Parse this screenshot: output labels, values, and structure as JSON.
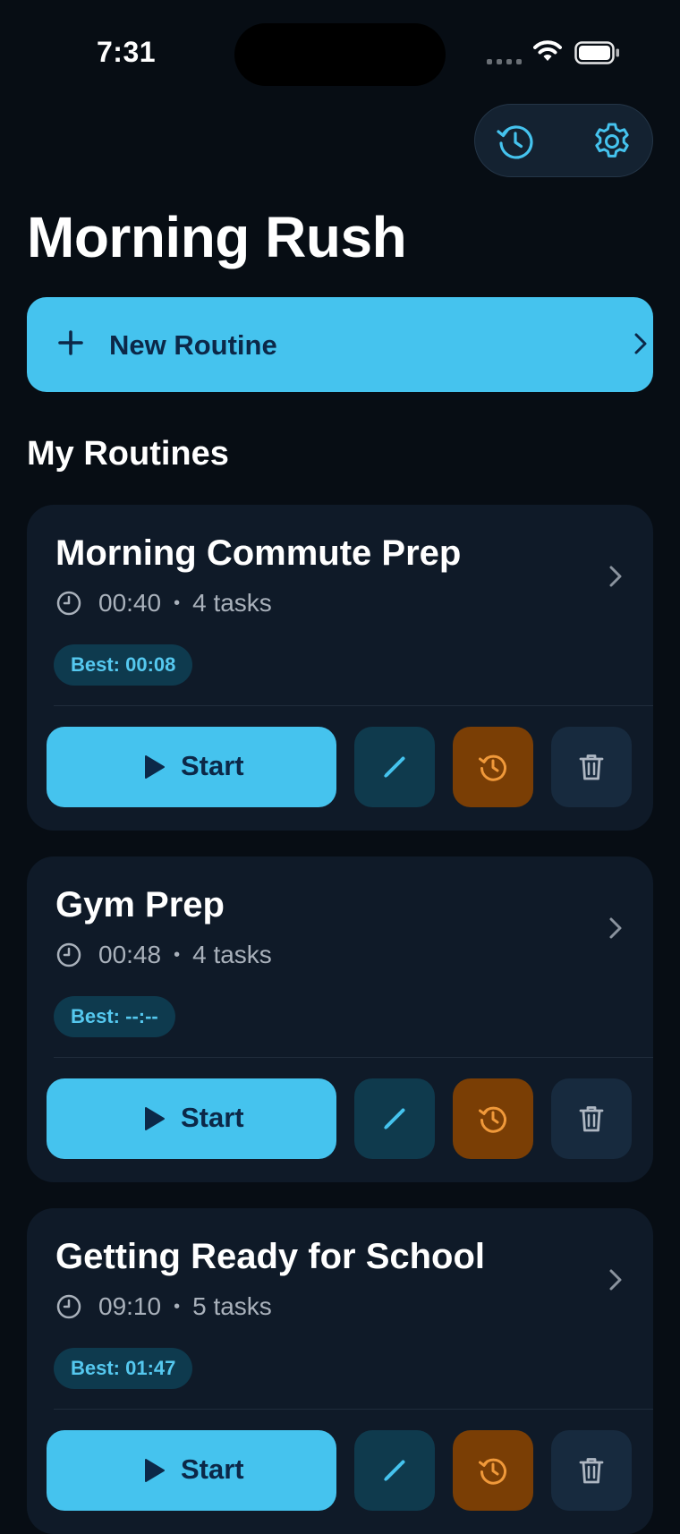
{
  "status_bar": {
    "time": "7:31"
  },
  "header": {
    "history_icon": "history-icon",
    "settings_icon": "gear-icon"
  },
  "app": {
    "title": "Morning Rush"
  },
  "new_routine": {
    "label": "New Routine"
  },
  "section": {
    "title": "My Routines"
  },
  "routines": [
    {
      "name": "Morning Commute Prep",
      "duration": "00:40",
      "tasks": "4 tasks",
      "best": "Best: 00:08",
      "start_label": "Start"
    },
    {
      "name": "Gym Prep",
      "duration": "00:48",
      "tasks": "4 tasks",
      "best": "Best: --:--",
      "start_label": "Start"
    },
    {
      "name": "Getting Ready for School",
      "duration": "09:10",
      "tasks": "5 tasks",
      "best": "Best: 01:47",
      "start_label": "Start"
    }
  ],
  "colors": {
    "background": "#070d14",
    "accent": "#45c3ee",
    "card": "#0f1a28",
    "history_button": "#7a3e05",
    "history_icon": "#f0993a"
  }
}
